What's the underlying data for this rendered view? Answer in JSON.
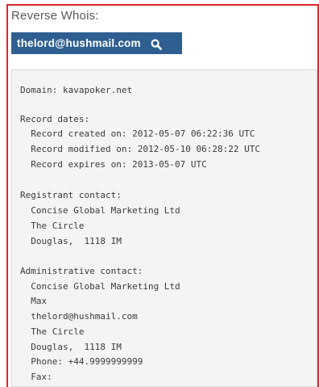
{
  "section_title": "Reverse Whois:",
  "search": {
    "label": "thelord@hushmail.com",
    "icon": "search-icon"
  },
  "whois": {
    "lines": [
      "Domain: kavapoker.net",
      "Record dates:",
      "  Record created on: 2012-05-07 06:22:36 UTC",
      "  Record modified on: 2012-05-10 06:28:22 UTC",
      "  Record expires on: 2013-05-07 UTC",
      "Registrant contact:",
      "  Concise Global Marketing Ltd",
      "  The Circle",
      "  Douglas,  1118 IM",
      "Administrative contact:",
      "  Concise Global Marketing Ltd",
      "  Max",
      "  thelord@hushmail.com",
      "  The Circle",
      "  Douglas,  1118 IM",
      "  Phone: +44.9999999999",
      "  Fax:"
    ]
  },
  "colors": {
    "frame_border": "#e0242b",
    "button_bg": "#2f5f91",
    "button_text": "#ffffff",
    "box_bg": "#f4f4f4"
  }
}
